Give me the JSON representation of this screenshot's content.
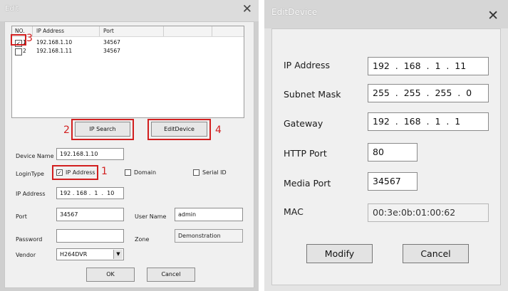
{
  "left_dialog": {
    "title": "Edit",
    "close": "✕",
    "list": {
      "headers": [
        "NO.",
        "IP Address",
        "Port"
      ],
      "rows": [
        {
          "no": "1",
          "ip": "192.168.1.10",
          "port": "34567",
          "checked": true
        },
        {
          "no": "2",
          "ip": "192.168.1.11",
          "port": "34567",
          "checked": false
        }
      ]
    },
    "ip_search_label": "IP Search",
    "edit_device_label": "EditDevice",
    "device_name_label": "Device Name",
    "device_name_value": "192.168.1.10",
    "login_type_label": "LoginType",
    "ip_address_option": "IP Address",
    "domain_option": "Domain",
    "serial_id_option": "Serial ID",
    "ip_address_label": "IP Address",
    "ip_address_value": "192 . 168 .  1  .  10",
    "port_label": "Port",
    "port_value": "34567",
    "user_name_label": "User Name",
    "user_name_value": "admin",
    "password_label": "Password",
    "password_value": "",
    "zone_label": "Zone",
    "zone_value": "Demonstration",
    "vendor_label": "Vendor",
    "vendor_value": "H264DVR",
    "ok_label": "OK",
    "cancel_label": "Cancel",
    "annotations": {
      "n1": "1",
      "n2": "2",
      "n3": "3",
      "n4": "4"
    }
  },
  "right_dialog": {
    "title": "EditDevice",
    "close": "✕",
    "ip_address_label": "IP Address",
    "ip_address_value": "192  .  168  .  1  .  11",
    "subnet_mask_label": "Subnet Mask",
    "subnet_mask_value": "255  .  255  .  255  .  0",
    "gateway_label": "Gateway",
    "gateway_value": "192  .  168  .  1  .  1",
    "http_port_label": "HTTP Port",
    "http_port_value": "80",
    "media_port_label": "Media Port",
    "media_port_value": "34567",
    "mac_label": "MAC",
    "mac_value": "00:3e:0b:01:00:62",
    "modify_label": "Modify",
    "cancel_label": "Cancel"
  },
  "colors": {
    "annotation_red": "#d21f1f"
  }
}
